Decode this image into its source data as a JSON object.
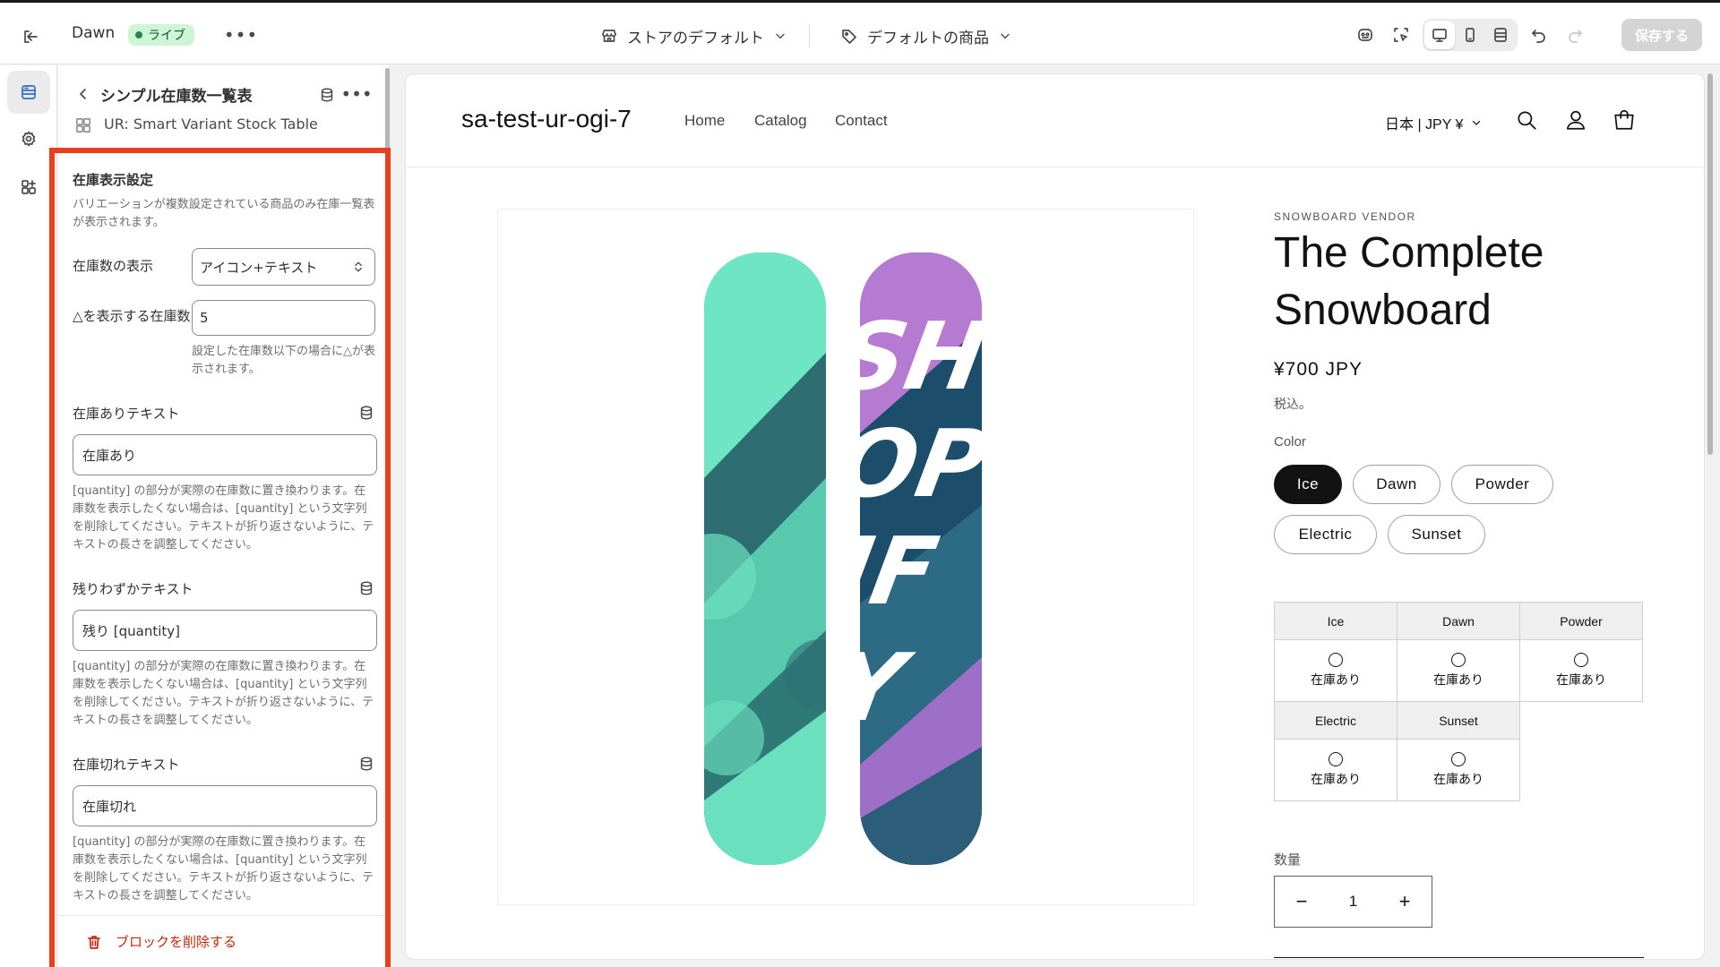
{
  "topbar": {
    "theme_name": "Dawn",
    "status_badge": "ライブ",
    "more_label": "•••",
    "store_selector": "ストアのデフォルト",
    "product_selector": "デフォルトの商品",
    "save_label": "保存する"
  },
  "panel": {
    "title": "シンプル在庫数一覧表",
    "app_name": "UR: Smart Variant Stock Table",
    "section_title": "在庫表示設定",
    "section_desc": "バリエーションが複数設定されている商品のみ在庫一覧表が表示されます。",
    "stock_display": {
      "label": "在庫数の表示",
      "value": "アイコン+テキスト"
    },
    "threshold": {
      "label": "△を表示する在庫数",
      "value": "5",
      "help": "設定した在庫数以下の場合に△が表示されます。"
    },
    "in_stock": {
      "label": "在庫ありテキスト",
      "value": "在庫あり",
      "help": "[quantity] の部分が実際の在庫数に置き換わります。在庫数を表示したくない場合は、[quantity] という文字列を削除してください。テキストが折り返さないように、テキストの長さを調整してください。"
    },
    "low_stock": {
      "label": "残りわずかテキスト",
      "value": "残り [quantity]",
      "help": "[quantity] の部分が実際の在庫数に置き換わります。在庫数を表示したくない場合は、[quantity] という文字列を削除してください。テキストが折り返さないように、テキストの長さを調整してください。"
    },
    "out_stock": {
      "label": "在庫切れテキスト",
      "value": "在庫切れ",
      "help": "[quantity] の部分が実際の在庫数に置き換わります。在庫数を表示したくない場合は、[quantity] という文字列を削除してください。テキストが折り返さないように、テキストの長さを調整してください。"
    },
    "delete_label": "ブロックを削除する"
  },
  "store": {
    "name": "sa-test-ur-ogi-7",
    "nav": [
      "Home",
      "Catalog",
      "Contact"
    ],
    "locale": "日本 | JPY ¥",
    "vendor": "SNOWBOARD VENDOR",
    "product_title": "The Complete Snowboard",
    "price": "¥700 JPY",
    "tax_note": "税込。",
    "option_label": "Color",
    "colors": [
      "Ice",
      "Dawn",
      "Powder",
      "Electric",
      "Sunset"
    ],
    "selected_color": "Ice",
    "stock_table": {
      "row1": [
        "Ice",
        "Dawn",
        "Powder"
      ],
      "row2": [
        "Electric",
        "Sunset"
      ],
      "status": "在庫あり"
    },
    "qty_label": "数量",
    "qty_value": "1",
    "qty_minus": "−",
    "qty_plus": "+"
  },
  "colors": {
    "accent": "#e8401c",
    "live": "#29845a",
    "selected_pill": "#121212"
  },
  "icons": [
    "exit-icon",
    "store-icon",
    "tag-icon",
    "sections-icon",
    "settings-icon",
    "apps-icon",
    "database-icon",
    "trash-icon",
    "search-icon",
    "account-icon",
    "cart-icon",
    "undo-icon",
    "redo-icon"
  ]
}
